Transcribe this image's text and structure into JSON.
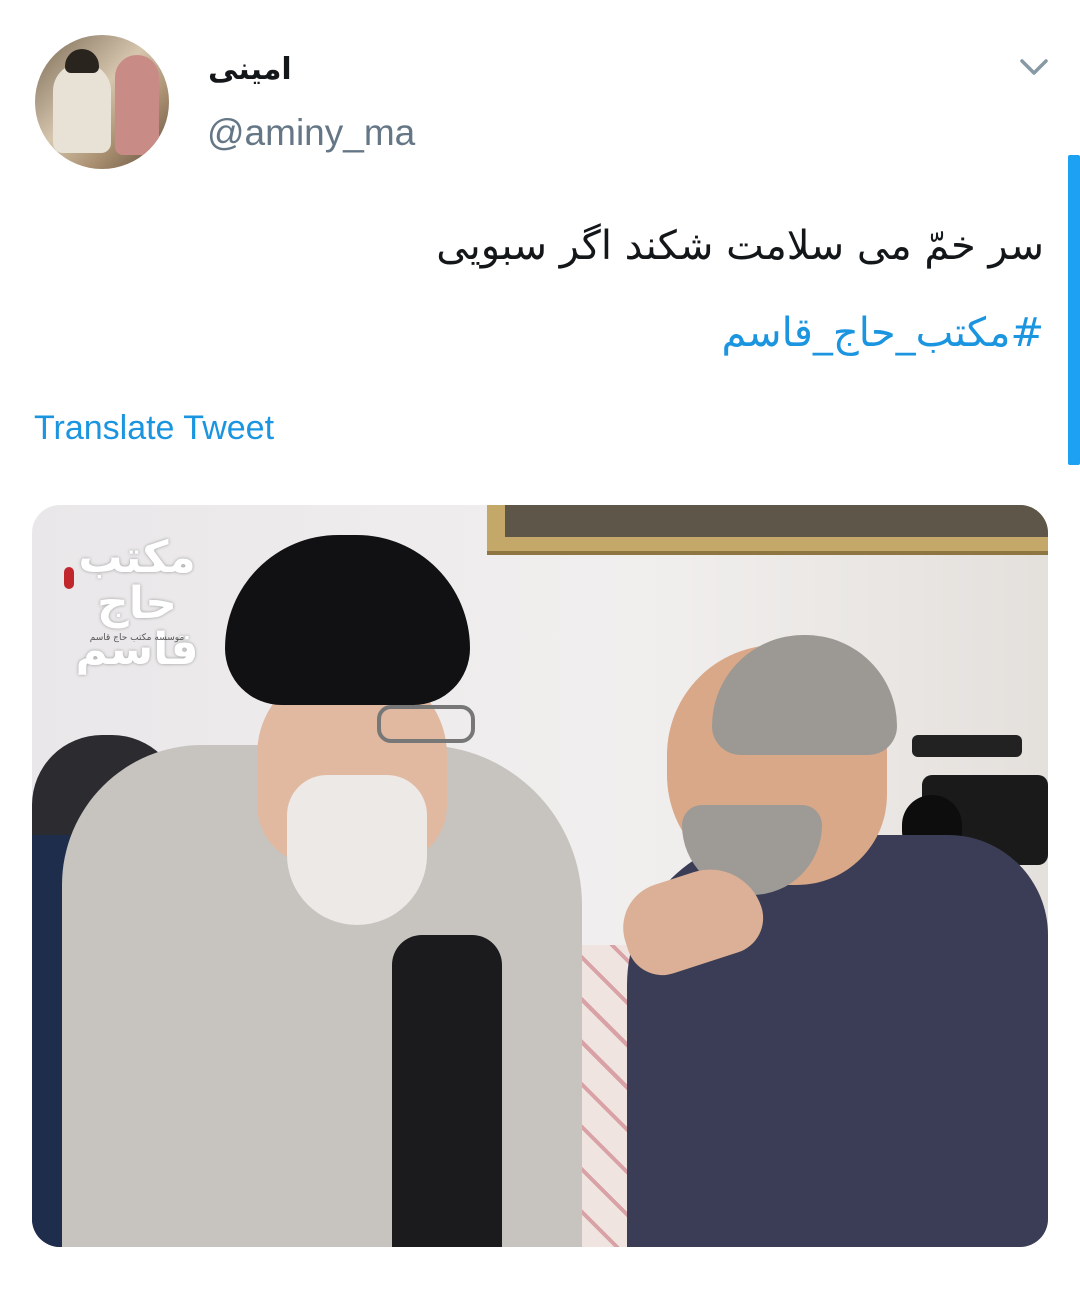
{
  "tweet": {
    "author_name": "امینی",
    "handle": "@aminy_ma",
    "text": "سر خمّ می سلامت شکند اگر سبویی",
    "hashtag": "#مکتب_حاج_قاسم",
    "translate_label": "Translate Tweet"
  },
  "media": {
    "logo_text": "مکتب حاج قاسم",
    "logo_subtext": "موسسه مکتب حاج قاسم"
  },
  "icons": {
    "menu": "chevron-down-icon"
  },
  "colors": {
    "link": "#1b95e0",
    "secondary_text": "#657786",
    "scrollbar": "#1da1f2"
  }
}
